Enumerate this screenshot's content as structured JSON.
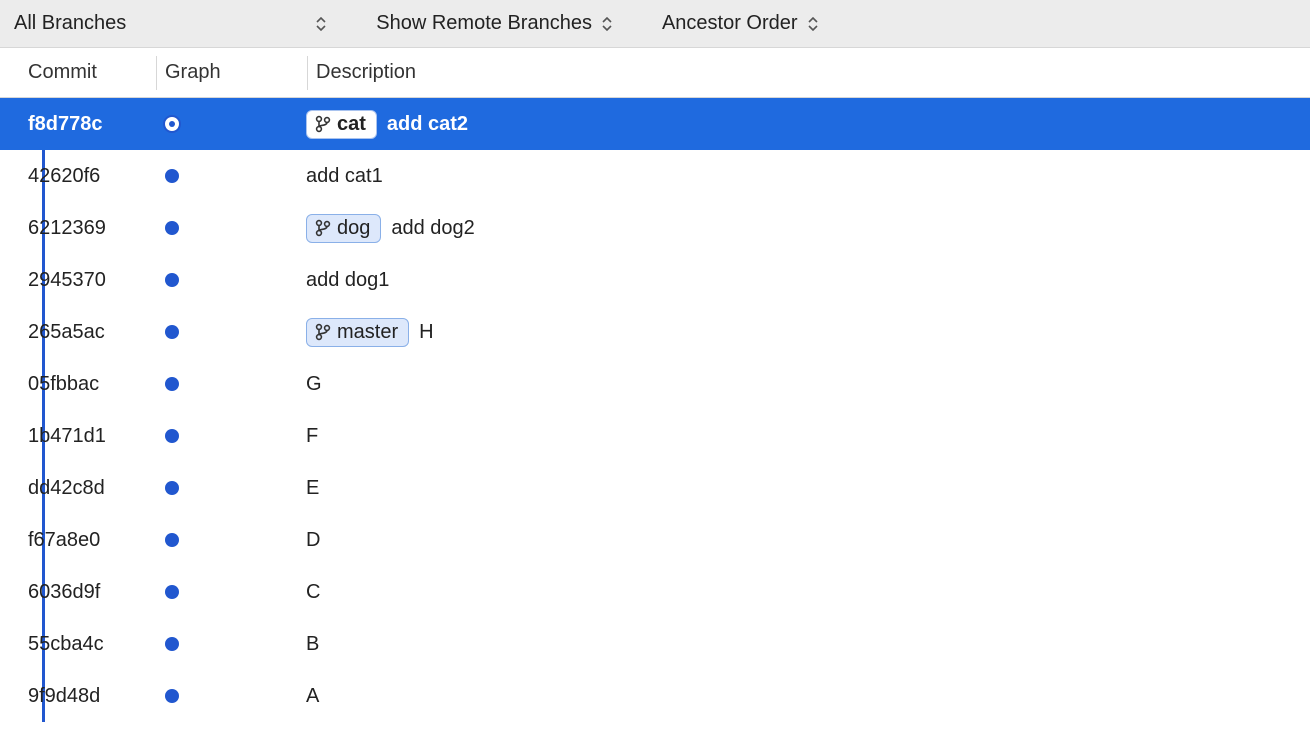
{
  "toolbar": {
    "branch_filter": "All Branches",
    "remote_filter": "Show Remote Branches",
    "order_filter": "Ancestor Order"
  },
  "columns": {
    "commit": "Commit",
    "graph": "Graph",
    "description": "Description"
  },
  "commits": [
    {
      "hash": "f8d778c",
      "branch": "cat",
      "message": "add cat2",
      "selected": true
    },
    {
      "hash": "42620f6",
      "branch": null,
      "message": "add cat1",
      "selected": false
    },
    {
      "hash": "6212369",
      "branch": "dog",
      "message": "add dog2",
      "selected": false
    },
    {
      "hash": "2945370",
      "branch": null,
      "message": "add dog1",
      "selected": false
    },
    {
      "hash": "265a5ac",
      "branch": "master",
      "message": "H",
      "selected": false
    },
    {
      "hash": "05fbbac",
      "branch": null,
      "message": "G",
      "selected": false
    },
    {
      "hash": "1b471d1",
      "branch": null,
      "message": "F",
      "selected": false
    },
    {
      "hash": "dd42c8d",
      "branch": null,
      "message": "E",
      "selected": false
    },
    {
      "hash": "f67a8e0",
      "branch": null,
      "message": "D",
      "selected": false
    },
    {
      "hash": "6036d9f",
      "branch": null,
      "message": "C",
      "selected": false
    },
    {
      "hash": "55cba4c",
      "branch": null,
      "message": "B",
      "selected": false
    },
    {
      "hash": "9f9d48d",
      "branch": null,
      "message": "A",
      "selected": false
    }
  ]
}
